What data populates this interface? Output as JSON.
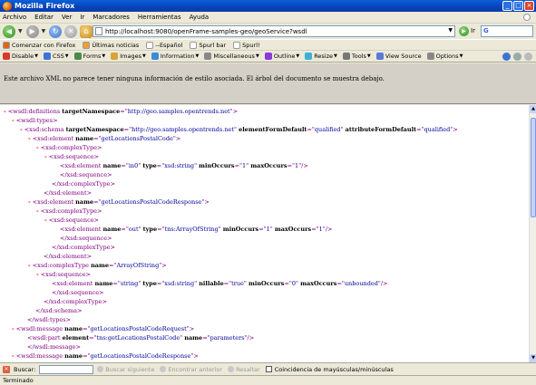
{
  "window": {
    "title": "Mozilla Firefox"
  },
  "menu": [
    "Archivo",
    "Editar",
    "Ver",
    "Ir",
    "Marcadores",
    "Herramientas",
    "Ayuda"
  ],
  "navigation": {
    "url": "http://localhost:9080/openFrame-samples-geo/geoService?wsdl",
    "go_label": "Ir",
    "search_prefix": "G"
  },
  "bookmarks": [
    {
      "label": "Comenzar con Firefox",
      "color": "#e2641a"
    },
    {
      "label": "Últimas noticias",
      "color": "#f0a030"
    },
    {
      "label": "--Español",
      "color": "#ffffff"
    },
    {
      "label": "Spurl bar",
      "color": "#ffffff"
    },
    {
      "label": "Spurl!",
      "color": "#ffffff"
    }
  ],
  "devbar": [
    {
      "label": "Disable",
      "color": "#d83a2a"
    },
    {
      "label": "CSS",
      "color": "#3a74d8"
    },
    {
      "label": "Forms",
      "color": "#4a8a4a"
    },
    {
      "label": "Images",
      "color": "#d8a33a"
    },
    {
      "label": "Information",
      "color": "#3a8ad8"
    },
    {
      "label": "Miscellaneous",
      "color": "#888888"
    },
    {
      "label": "Outline",
      "color": "#8a3ad8"
    },
    {
      "label": "Resize",
      "color": "#3ab0d8"
    },
    {
      "label": "Tools",
      "color": "#777777"
    },
    {
      "label": "View Source",
      "color": "#5a7ad8"
    },
    {
      "label": "Options",
      "color": "#888888"
    }
  ],
  "info_message": "Este archivo XML no parece tener ninguna información de estilo asociada. El árbol del documento se muestra debajo.",
  "xml": [
    {
      "m": "-",
      "parts": [
        [
          "tg",
          "<wsdl:definitions "
        ],
        [
          "an",
          "targetNamespace"
        ],
        [
          "tg",
          "=\""
        ],
        [
          "av",
          "http://geo.samples.opentrends.net"
        ],
        [
          "tg",
          "\">"
        ]
      ]
    },
    {
      "m": "-",
      "parts": [
        [
          "tg",
          "<wsdl:types>"
        ]
      ]
    },
    {
      "m": "-",
      "parts": [
        [
          "tg",
          "<xsd:schema "
        ],
        [
          "an",
          "targetNamespace"
        ],
        [
          "tg",
          "=\""
        ],
        [
          "av",
          "http://geo.samples.opentrends.net"
        ],
        [
          "tg",
          "\" "
        ],
        [
          "an",
          "elementFormDefault"
        ],
        [
          "tg",
          "=\""
        ],
        [
          "av",
          "qualified"
        ],
        [
          "tg",
          "\" "
        ],
        [
          "an",
          "attributeFormDefault"
        ],
        [
          "tg",
          "=\""
        ],
        [
          "av",
          "qualified"
        ],
        [
          "tg",
          "\">"
        ]
      ]
    },
    {
      "m": "-",
      "parts": [
        [
          "tg",
          "<xsd:element "
        ],
        [
          "an",
          "name"
        ],
        [
          "tg",
          "=\""
        ],
        [
          "av",
          "getLocationsPostalCode"
        ],
        [
          "tg",
          "\">"
        ]
      ]
    },
    {
      "m": "-",
      "parts": [
        [
          "tg",
          "<xsd:complexType>"
        ]
      ]
    },
    {
      "m": "-",
      "parts": [
        [
          "tg",
          "<xsd:sequence>"
        ]
      ]
    },
    {
      "m": "",
      "parts": [
        [
          "tg",
          "<xsd:element "
        ],
        [
          "an",
          "name"
        ],
        [
          "tg",
          "=\""
        ],
        [
          "av",
          "in0"
        ],
        [
          "tg",
          "\" "
        ],
        [
          "an",
          "type"
        ],
        [
          "tg",
          "=\""
        ],
        [
          "av",
          "xsd:string"
        ],
        [
          "tg",
          "\" "
        ],
        [
          "an",
          "minOccurs"
        ],
        [
          "tg",
          "=\""
        ],
        [
          "av",
          "1"
        ],
        [
          "tg",
          "\" "
        ],
        [
          "an",
          "maxOccurs"
        ],
        [
          "tg",
          "=\""
        ],
        [
          "av",
          "1"
        ],
        [
          "tg",
          "\"/>"
        ]
      ]
    },
    {
      "m": "",
      "parts": [
        [
          "tg",
          "</xsd:sequence>"
        ]
      ]
    },
    {
      "m": "",
      "parts": [
        [
          "tg",
          "</xsd:complexType>"
        ]
      ]
    },
    {
      "m": "",
      "parts": [
        [
          "tg",
          "</xsd:element>"
        ]
      ]
    },
    {
      "m": "-",
      "parts": [
        [
          "tg",
          "<xsd:element "
        ],
        [
          "an",
          "name"
        ],
        [
          "tg",
          "=\""
        ],
        [
          "av",
          "getLocationsPostalCodeResponse"
        ],
        [
          "tg",
          "\">"
        ]
      ]
    },
    {
      "m": "-",
      "parts": [
        [
          "tg",
          "<xsd:complexType>"
        ]
      ]
    },
    {
      "m": "-",
      "parts": [
        [
          "tg",
          "<xsd:sequence>"
        ]
      ]
    },
    {
      "m": "",
      "parts": [
        [
          "tg",
          "<xsd:element "
        ],
        [
          "an",
          "name"
        ],
        [
          "tg",
          "=\""
        ],
        [
          "av",
          "out"
        ],
        [
          "tg",
          "\" "
        ],
        [
          "an",
          "type"
        ],
        [
          "tg",
          "=\""
        ],
        [
          "av",
          "tns:ArrayOfString"
        ],
        [
          "tg",
          "\" "
        ],
        [
          "an",
          "minOccurs"
        ],
        [
          "tg",
          "=\""
        ],
        [
          "av",
          "1"
        ],
        [
          "tg",
          "\" "
        ],
        [
          "an",
          "maxOccurs"
        ],
        [
          "tg",
          "=\""
        ],
        [
          "av",
          "1"
        ],
        [
          "tg",
          "\"/>"
        ]
      ]
    },
    {
      "m": "",
      "parts": [
        [
          "tg",
          "</xsd:sequence>"
        ]
      ]
    },
    {
      "m": "",
      "parts": [
        [
          "tg",
          "</xsd:complexType>"
        ]
      ]
    },
    {
      "m": "",
      "parts": [
        [
          "tg",
          "</xsd:element>"
        ]
      ]
    },
    {
      "m": "-",
      "parts": [
        [
          "tg",
          "<xsd:complexType "
        ],
        [
          "an",
          "name"
        ],
        [
          "tg",
          "=\""
        ],
        [
          "av",
          "ArrayOfString"
        ],
        [
          "tg",
          "\">"
        ]
      ]
    },
    {
      "m": "-",
      "parts": [
        [
          "tg",
          "<xsd:sequence>"
        ]
      ]
    },
    {
      "m": "",
      "parts": [
        [
          "tg",
          "<xsd:element "
        ],
        [
          "an",
          "name"
        ],
        [
          "tg",
          "=\""
        ],
        [
          "av",
          "string"
        ],
        [
          "tg",
          "\" "
        ],
        [
          "an",
          "type"
        ],
        [
          "tg",
          "=\""
        ],
        [
          "av",
          "xsd:string"
        ],
        [
          "tg",
          "\" "
        ],
        [
          "an",
          "nillable"
        ],
        [
          "tg",
          "=\""
        ],
        [
          "av",
          "true"
        ],
        [
          "tg",
          "\" "
        ],
        [
          "an",
          "minOccurs"
        ],
        [
          "tg",
          "=\""
        ],
        [
          "av",
          "0"
        ],
        [
          "tg",
          "\" "
        ],
        [
          "an",
          "maxOccurs"
        ],
        [
          "tg",
          "=\""
        ],
        [
          "av",
          "unbounded"
        ],
        [
          "tg",
          "\"/>"
        ]
      ]
    },
    {
      "m": "",
      "parts": [
        [
          "tg",
          "</xsd:sequence>"
        ]
      ]
    },
    {
      "m": "",
      "parts": [
        [
          "tg",
          "</xsd:complexType>"
        ]
      ]
    },
    {
      "m": "",
      "parts": [
        [
          "tg",
          "</xsd:schema>"
        ]
      ]
    },
    {
      "m": "",
      "parts": [
        [
          "tg",
          "</wsdl:types>"
        ]
      ]
    },
    {
      "m": "-",
      "parts": [
        [
          "tg",
          "<wsdl:message "
        ],
        [
          "an",
          "name"
        ],
        [
          "tg",
          "=\""
        ],
        [
          "av",
          "getLocationsPostalCodeRequest"
        ],
        [
          "tg",
          "\">"
        ]
      ]
    },
    {
      "m": "",
      "parts": [
        [
          "tg",
          "<wsdl:part "
        ],
        [
          "an",
          "element"
        ],
        [
          "tg",
          "=\""
        ],
        [
          "av",
          "tns:getLocationsPostalCode"
        ],
        [
          "tg",
          "\" "
        ],
        [
          "an",
          "name"
        ],
        [
          "tg",
          "=\""
        ],
        [
          "av",
          "parameters"
        ],
        [
          "tg",
          "\"/>"
        ]
      ]
    },
    {
      "m": "",
      "parts": [
        [
          "tg",
          "</wsdl:message>"
        ]
      ]
    },
    {
      "m": "-",
      "parts": [
        [
          "tg",
          "<wsdl:message "
        ],
        [
          "an",
          "name"
        ],
        [
          "tg",
          "=\""
        ],
        [
          "av",
          "getLocationsPostalCodeResponse"
        ],
        [
          "tg",
          "\">"
        ]
      ]
    }
  ],
  "findbar": {
    "label": "Buscar:",
    "next": "Buscar siguiente",
    "prev": "Encontrar anterior",
    "highlight": "Resaltar",
    "match_case": "Coincidencia de mayúsculas/minúsculas"
  },
  "status": "Terminado"
}
